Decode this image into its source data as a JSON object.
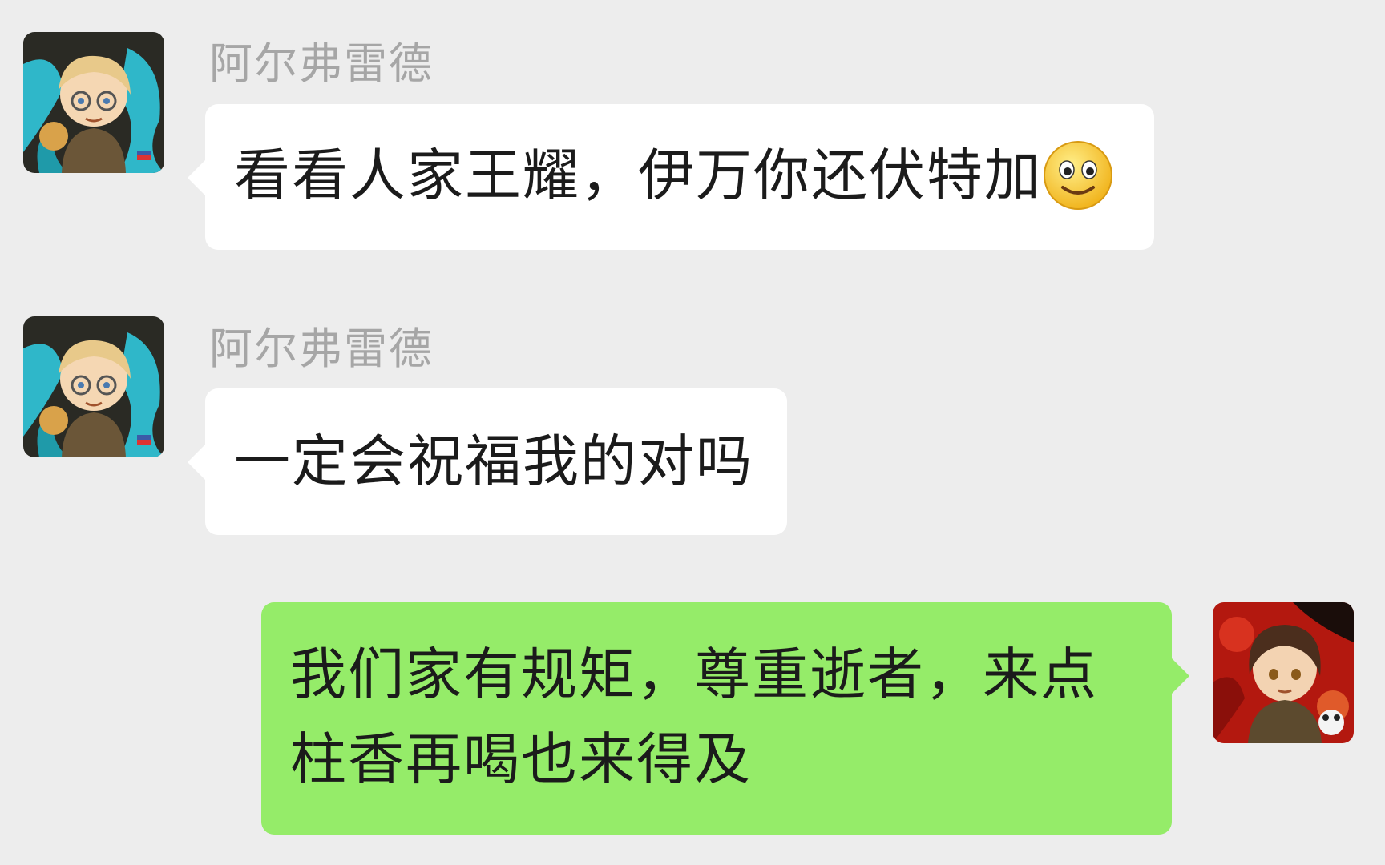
{
  "messages": [
    {
      "side": "left",
      "sender": "阿尔弗雷德",
      "text": "看看人家王耀，伊万你还伏特加",
      "emoji": "smile-emoji",
      "avatar": "alfred-avatar"
    },
    {
      "side": "left",
      "sender": "阿尔弗雷德",
      "text": "一定会祝福我的对吗",
      "avatar": "alfred-avatar"
    },
    {
      "side": "right",
      "text_line1": "我们家有规矩，尊重逝者，来点",
      "text_line2": "柱香再喝也来得及",
      "avatar": "wang-yao-avatar"
    }
  ],
  "colors": {
    "background": "#ededed",
    "incoming_bubble": "#ffffff",
    "outgoing_bubble": "#95ec69",
    "sender_name": "#a6a6a6"
  }
}
